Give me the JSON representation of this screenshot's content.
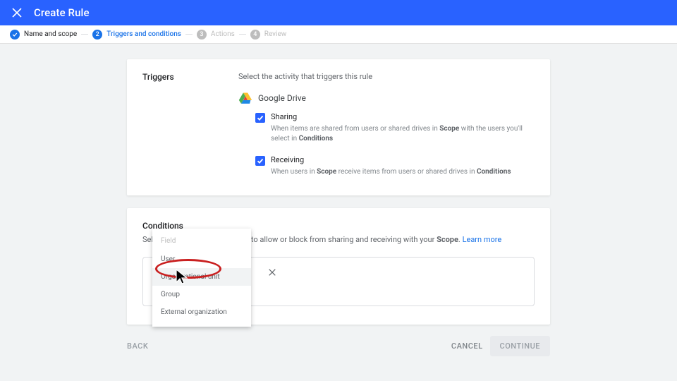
{
  "header": {
    "title": "Create Rule"
  },
  "steps": {
    "s1": "Name and scope",
    "s2": "Triggers and conditions",
    "s3": "Actions",
    "s4": "Review"
  },
  "triggers": {
    "label": "Triggers",
    "prompt": "Select the activity that triggers this rule",
    "drive": "Google Drive",
    "sharing": {
      "title": "Sharing",
      "desc_pre": "When items are shared from users or shared drives in ",
      "scope": "Scope",
      "desc_mid": " with the users you'll select in ",
      "conditions": "Conditions"
    },
    "receiving": {
      "title": "Receiving",
      "desc_pre": "When users in ",
      "scope": "Scope",
      "desc_mid": " receive items from users or shared drives in ",
      "conditions": "Conditions"
    }
  },
  "conditions": {
    "label": "Conditions",
    "desc_pre": "Select the other party you want to allow or block from sharing and receiving with your ",
    "scope": "Scope",
    "period": ". ",
    "learn": "Learn more"
  },
  "dropdown": {
    "header": "Field",
    "items": [
      "User",
      "Organizational unit",
      "Group",
      "External organization"
    ]
  },
  "footer": {
    "back": "BACK",
    "cancel": "CANCEL",
    "cont": "CONTINUE"
  }
}
